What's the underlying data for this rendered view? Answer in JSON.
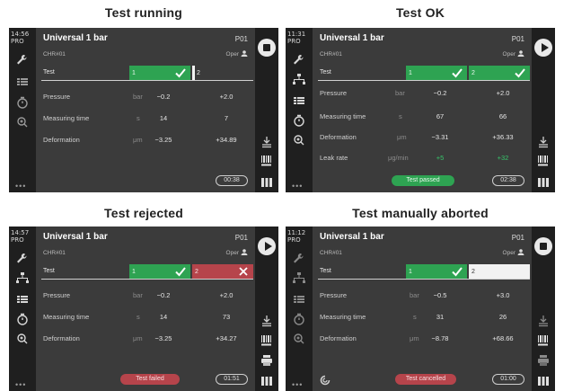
{
  "panels": [
    {
      "caption": "Test running",
      "clock": "14:56",
      "mode": "PRO",
      "title": "Universal 1 bar",
      "program": "P01",
      "chr": "CHR#01",
      "oper": "Oper",
      "test_label": "Test",
      "box1_num": "1",
      "box2_num": "2",
      "pressure": {
        "label": "Pressure",
        "unit": "bar",
        "v1": "−0.2",
        "v2": "+2.0"
      },
      "mtime": {
        "label": "Measuring time",
        "unit": "s",
        "v1": "14",
        "v2": "7"
      },
      "deform": {
        "label": "Deformation",
        "unit": "μm",
        "v1": "−3.25",
        "v2": "+34.89"
      },
      "timer": "00:38",
      "button": "stop"
    },
    {
      "caption": "Test OK",
      "clock": "11:31",
      "mode": "PRO",
      "title": "Universal 1 bar",
      "program": "P01",
      "chr": "CHR#01",
      "oper": "Oper",
      "test_label": "Test",
      "box1_num": "1",
      "box2_num": "2",
      "pressure": {
        "label": "Pressure",
        "unit": "bar",
        "v1": "−0.2",
        "v2": "+2.0"
      },
      "mtime": {
        "label": "Measuring time",
        "unit": "s",
        "v1": "67",
        "v2": "66"
      },
      "deform": {
        "label": "Deformation",
        "unit": "μm",
        "v1": "−3.31",
        "v2": "+36.33"
      },
      "leak": {
        "label": "Leak rate",
        "unit": "μg/min",
        "v1": "+5",
        "v2": "+32"
      },
      "status": "Test passed",
      "timer": "02:38",
      "button": "play"
    },
    {
      "caption": "Test rejected",
      "clock": "14:57",
      "mode": "PRO",
      "title": "Universal 1 bar",
      "program": "P01",
      "chr": "CHR#01",
      "oper": "Oper",
      "test_label": "Test",
      "box1_num": "1",
      "box2_num": "2",
      "pressure": {
        "label": "Pressure",
        "unit": "bar",
        "v1": "−0.2",
        "v2": "+2.0"
      },
      "mtime": {
        "label": "Measuring time",
        "unit": "s",
        "v1": "14",
        "v2": "73"
      },
      "deform": {
        "label": "Deformation",
        "unit": "μm",
        "v1": "−3.25",
        "v2": "+34.27"
      },
      "status": "Test failed",
      "timer": "01:51",
      "button": "play"
    },
    {
      "caption": "Test manually aborted",
      "clock": "11:12",
      "mode": "PRO",
      "title": "Universal 1 bar",
      "program": "P01",
      "chr": "CHR#01",
      "oper": "Oper",
      "test_label": "Test",
      "box1_num": "1",
      "box2_num": "2",
      "pressure": {
        "label": "Pressure",
        "unit": "bar",
        "v1": "−0.5",
        "v2": "+3.0"
      },
      "mtime": {
        "label": "Measuring time",
        "unit": "s",
        "v1": "31",
        "v2": "26"
      },
      "deform": {
        "label": "Deformation",
        "unit": "μm",
        "v1": "−8.78",
        "v2": "+68.66"
      },
      "status": "Test cancelled",
      "timer": "01:00",
      "button": "stop"
    }
  ],
  "colors": {
    "pass": "#2ea352",
    "fail": "#b6444b",
    "screen": "#3b3b3b",
    "sidebar": "#1f1f1f"
  },
  "icons": [
    "wrench-icon",
    "network-icon",
    "list-icon",
    "timer-icon",
    "zoom-icon",
    "download-icon",
    "barcode-icon",
    "printer-icon",
    "columns-icon",
    "stop-icon",
    "play-icon",
    "checkmark-icon",
    "cross-icon",
    "user-icon",
    "spinner-icon"
  ]
}
